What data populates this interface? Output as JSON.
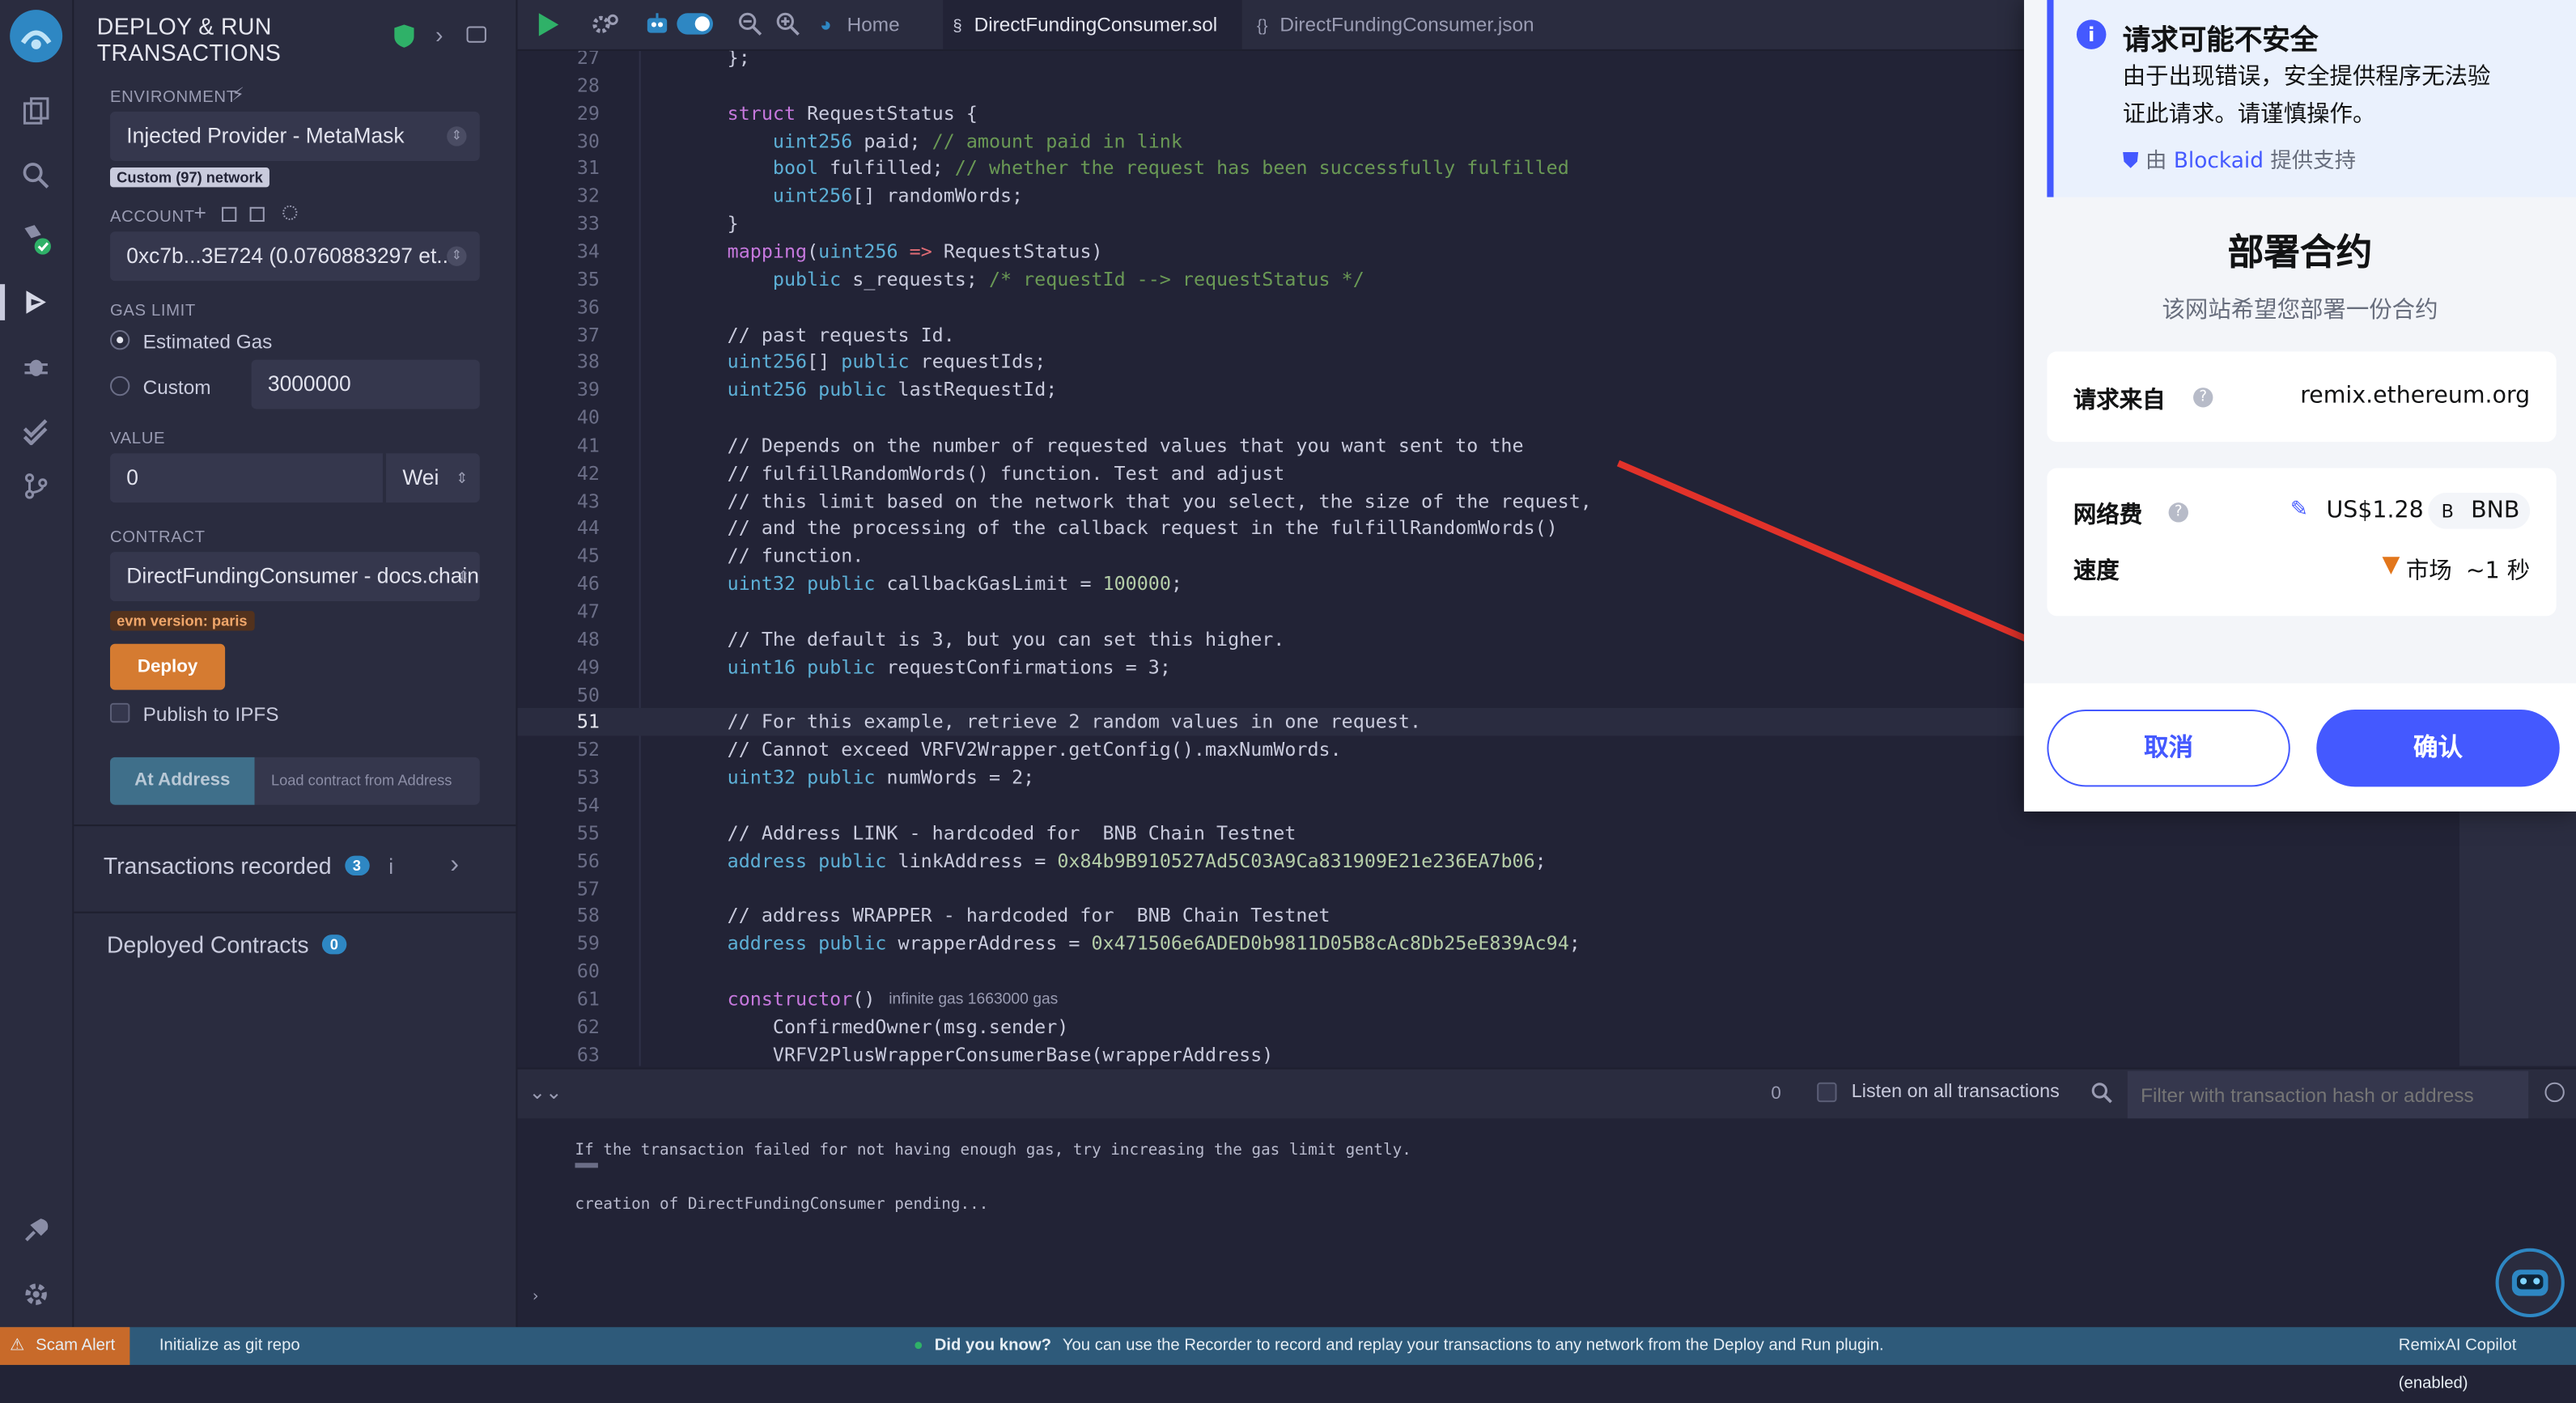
{
  "panel": {
    "title_line1": "DEPLOY & RUN",
    "title_line2": "TRANSACTIONS",
    "environment_label": "ENVIRONMENT",
    "environment_value": "Injected Provider - MetaMask",
    "network_badge": "Custom (97) network",
    "account_label": "ACCOUNT",
    "account_value": "0xc7b...3E724 (0.0760883297 et...",
    "gas_limit_label": "GAS LIMIT",
    "estimated_gas": "Estimated Gas",
    "custom": "Custom",
    "custom_gas_value": "3000000",
    "value_label": "VALUE",
    "value_amount": "0",
    "value_unit": "Wei",
    "contract_label": "CONTRACT",
    "contract_value": "DirectFundingConsumer - docs.chain",
    "evm_badge": "evm version: paris",
    "deploy": "Deploy",
    "publish_ipfs": "Publish to IPFS",
    "at_address": "At Address",
    "load_contract": "Load contract from Address",
    "transactions_recorded": "Transactions recorded",
    "transactions_count": "3",
    "deployed_contracts": "Deployed Contracts",
    "deployed_count": "0"
  },
  "topbar": {
    "home": "Home",
    "tab_sol": "DirectFundingConsumer.sol",
    "tab_json": "DirectFundingConsumer.json"
  },
  "code": [
    {
      "n": "27",
      "t": "    };"
    },
    {
      "n": "28",
      "t": ""
    },
    {
      "n": "29",
      "t": "    struct RequestStatus {"
    },
    {
      "n": "30",
      "t": "        uint256 paid; // amount paid in link"
    },
    {
      "n": "31",
      "t": "        bool fulfilled; // whether the request has been successfully fulfilled"
    },
    {
      "n": "32",
      "t": "        uint256[] randomWords;"
    },
    {
      "n": "33",
      "t": "    }"
    },
    {
      "n": "34",
      "t": "    mapping(uint256 => RequestStatus)"
    },
    {
      "n": "35",
      "t": "        public s_requests; /* requestId --> requestStatus */"
    },
    {
      "n": "36",
      "t": ""
    },
    {
      "n": "37",
      "t": "    // past requests Id."
    },
    {
      "n": "38",
      "t": "    uint256[] public requestIds;"
    },
    {
      "n": "39",
      "t": "    uint256 public lastRequestId;"
    },
    {
      "n": "40",
      "t": ""
    },
    {
      "n": "41",
      "t": "    // Depends on the number of requested values that you want sent to the"
    },
    {
      "n": "42",
      "t": "    // fulfillRandomWords() function. Test and adjust"
    },
    {
      "n": "43",
      "t": "    // this limit based on the network that you select, the size of the request,"
    },
    {
      "n": "44",
      "t": "    // and the processing of the callback request in the fulfillRandomWords()"
    },
    {
      "n": "45",
      "t": "    // function."
    },
    {
      "n": "46",
      "t": "    uint32 public callbackGasLimit = 100000;"
    },
    {
      "n": "47",
      "t": ""
    },
    {
      "n": "48",
      "t": "    // The default is 3, but you can set this higher."
    },
    {
      "n": "49",
      "t": "    uint16 public requestConfirmations = 3;"
    },
    {
      "n": "50",
      "t": ""
    },
    {
      "n": "51",
      "t": "    // For this example, retrieve 2 random values in one request."
    },
    {
      "n": "52",
      "t": "    // Cannot exceed VRFV2Wrapper.getConfig().maxNumWords."
    },
    {
      "n": "53",
      "t": "    uint32 public numWords = 2;"
    },
    {
      "n": "54",
      "t": ""
    },
    {
      "n": "55",
      "t": "    // Address LINK - hardcoded for  BNB Chain Testnet"
    },
    {
      "n": "56",
      "t": "    address public linkAddress = 0x84b9B910527Ad5C03A9Ca831909E21e236EA7b06;"
    },
    {
      "n": "57",
      "t": ""
    },
    {
      "n": "58",
      "t": "    // address WRAPPER - hardcoded for  BNB Chain Testnet"
    },
    {
      "n": "59",
      "t": "    address public wrapperAddress = 0x471506e6ADED0b9811D05B8cAc8Db25eE839Ac94;"
    },
    {
      "n": "60",
      "t": ""
    },
    {
      "n": "61",
      "t": "    constructor()"
    },
    {
      "n": "62",
      "t": "        ConfirmedOwner(msg.sender)"
    },
    {
      "n": "63",
      "t": "        VRFV2PlusWrapperConsumerBase(wrapperAddress)"
    }
  ],
  "gas_hint": "infinite gas 1663000 gas",
  "terminal": {
    "count": "0",
    "listen": "Listen on all transactions",
    "filter_placeholder": "Filter with transaction hash or address",
    "line1": "If the transaction failed for not having enough gas, try increasing the gas limit gently.",
    "line2": "creation of DirectFundingConsumer pending..."
  },
  "status": {
    "scam": "Scam Alert",
    "git": "Initialize as git repo",
    "did_you_know": "Did you know?",
    "tip": "You can use the Recorder to record and replay your transactions to any network from the Deploy and Run plugin.",
    "copilot": "RemixAI Copilot (enabled)"
  },
  "metamask": {
    "warn_title": "请求可能不安全",
    "warn_body_1": "由于出现错误，安全提供程序无法验",
    "warn_body_2": "证此请求。请谨慎操作。",
    "by": "由",
    "blockaid": "Blockaid",
    "provided": "提供支持",
    "title": "部署合约",
    "subtitle": "该网站希望您部署一份合约",
    "request_from_label": "请求来自",
    "request_from_value": "remix.ethereum.org",
    "fee_label": "网络费",
    "fee_value": "US$1.28",
    "fee_token": "BNB",
    "speed_label": "速度",
    "speed_value": "市场",
    "speed_time": "~1 秒",
    "cancel": "取消",
    "confirm": "确认"
  },
  "colors": {
    "accent": "#4459ff",
    "deploy": "#d57b31",
    "status": "#2e5a7a",
    "arrow": "#e1322a"
  }
}
